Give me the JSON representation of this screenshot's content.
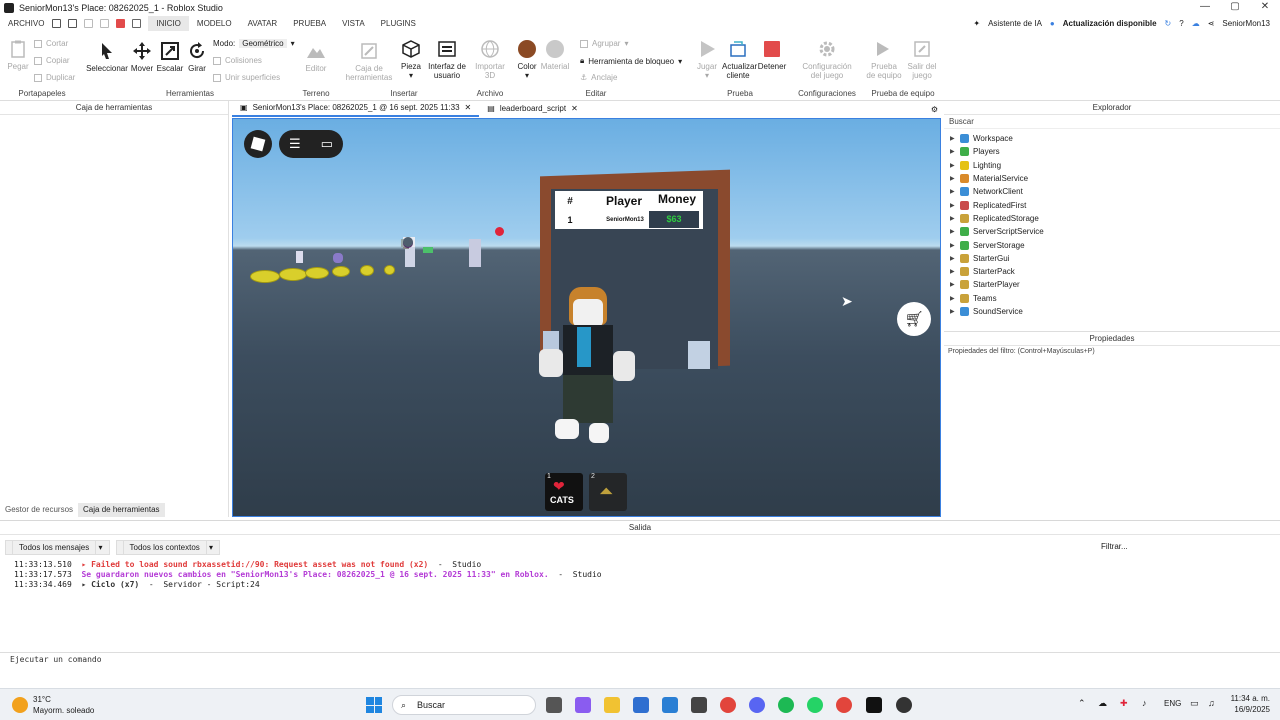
{
  "window": {
    "title": "SeniorMon13's Place: 08262025_1 - Roblox Studio"
  },
  "menu": {
    "items": [
      "ARCHIVO",
      "INICIO",
      "MODELO",
      "AVATAR",
      "PRUEBA",
      "VISTA",
      "PLUGINS"
    ],
    "active": "INICIO",
    "ai_assistant": "Asistente de IA",
    "update": "Actualización disponible",
    "user": "SeniorMon13"
  },
  "ribbon": {
    "clipboard": {
      "paste": "Pegar",
      "cut": "Cortar",
      "copy": "Copiar",
      "duplicate": "Duplicar",
      "group": "Portapapeles"
    },
    "tools": {
      "select": "Seleccionar",
      "move": "Mover",
      "scale": "Escalar",
      "rotate": "Girar",
      "mode_label": "Modo:",
      "mode_value": "Geométrico",
      "collisions": "Colisiones",
      "join": "Unir superficies",
      "group": "Herramientas"
    },
    "terrain": {
      "editor": "Editor",
      "group": "Terreno"
    },
    "insert": {
      "toolbox": "Caja de herramientas",
      "part": "Pieza",
      "ui": "Interfaz de usuario",
      "group": "Insertar"
    },
    "file": {
      "import3d": "Importar 3D",
      "group": "Archivo"
    },
    "edit": {
      "color": "Color",
      "material": "Material",
      "group_btn": "Agrupar",
      "lock": "Herramienta de bloqueo",
      "anchor": "Anclaje",
      "group": "Editar"
    },
    "test": {
      "play": "Jugar",
      "update_client": "Actualizar cliente",
      "stop": "Detener",
      "group": "Prueba"
    },
    "settings": {
      "game_settings": "Configuración del juego",
      "group": "Configuraciones"
    },
    "team_test": {
      "team_test": "Prueba de equipo",
      "exit_game": "Salir del juego",
      "group": "Prueba de equipo"
    }
  },
  "panels": {
    "toolbox_title": "Caja de herramientas",
    "toolbox_tabs": [
      "Gestor de recursos",
      "Caja de herramientas"
    ],
    "doc_tabs": [
      "SeniorMon13's Place: 08262025_1 @ 16 sept. 2025 11:33",
      "leaderboard_script"
    ],
    "explorer_title": "Explorador",
    "explorer_search": "Buscar",
    "explorer_nodes": [
      {
        "name": "Workspace",
        "color": "#3b8ed6"
      },
      {
        "name": "Players",
        "color": "#3fae49"
      },
      {
        "name": "Lighting",
        "color": "#e5c213"
      },
      {
        "name": "MaterialService",
        "color": "#d98a2a"
      },
      {
        "name": "NetworkClient",
        "color": "#3b8ed6"
      },
      {
        "name": "ReplicatedFirst",
        "color": "#c94a4a"
      },
      {
        "name": "ReplicatedStorage",
        "color": "#c9a23a"
      },
      {
        "name": "ServerScriptService",
        "color": "#3fae49"
      },
      {
        "name": "ServerStorage",
        "color": "#3fae49"
      },
      {
        "name": "StarterGui",
        "color": "#c9a23a"
      },
      {
        "name": "StarterPack",
        "color": "#c9a23a"
      },
      {
        "name": "StarterPlayer",
        "color": "#c9a23a"
      },
      {
        "name": "Teams",
        "color": "#c9a23a"
      },
      {
        "name": "SoundService",
        "color": "#3b8ed6"
      }
    ],
    "properties_title": "Propiedades",
    "properties_filter": "Propiedades del filtro: (Control+Mayúsculas+P)"
  },
  "leaderboard": {
    "headers": [
      "#",
      "Player",
      "Money"
    ],
    "rank": "1",
    "player": "SeniorMon13",
    "money": "$63"
  },
  "hotbar": [
    {
      "slot": "1",
      "label": "CATS"
    },
    {
      "slot": "2",
      "label": ""
    }
  ],
  "output": {
    "title": "Salida",
    "filter_messages": "Todos los mensajes",
    "filter_contexts": "Todos los contextos",
    "filter_placeholder": "Filtrar...",
    "lines": [
      {
        "time": "11:33:13.510",
        "text": "▸ Failed to load sound rbxassetid://90: Request asset was not found (x2)",
        "source": "  -  Studio",
        "color": "#e03b3b"
      },
      {
        "time": "11:33:17.573",
        "text": "Se guardaron nuevos cambios en \"SeniorMon13's Place: 08262025_1 @ 16 sept. 2025 11:33\" en Roblox.",
        "source": "  -  Studio",
        "color": "#b43bd6"
      },
      {
        "time": "11:33:34.469",
        "text": "▸ Ciclo (x7)",
        "source": "  -  Servidor - Script:24",
        "color": "#333333"
      }
    ],
    "command_placeholder": "Ejecutar un comando"
  },
  "taskbar": {
    "weather_temp": "31°C",
    "weather_desc": "Mayorm. soleado",
    "search": "Buscar",
    "lang": "ENG",
    "time": "11:34 a. m.",
    "date": "16/9/2025"
  },
  "colors": {
    "accent": "#3a80e0",
    "stop": "#e24b4b",
    "money": "#2ecc40"
  }
}
